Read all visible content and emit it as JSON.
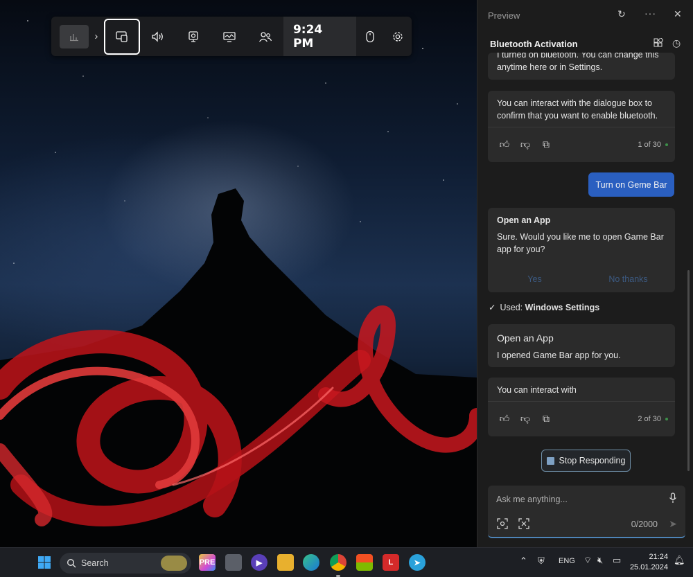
{
  "gamebar": {
    "time": "9:24 PM",
    "widgets": [
      "performance-icon",
      "capture-icon",
      "audio-icon",
      "webcam-icon",
      "display-icon",
      "social-icon"
    ]
  },
  "panel": {
    "header_label": "Preview",
    "title": "Bluetooth Activation",
    "msg1_partial": "I turned on bluetooth. You can change this anytime here or in Settings.",
    "msg2_line1": "You can interact with the dialogue box to",
    "msg2_line2": "confirm that you want to enable bluetooth.",
    "msg2_count": "1 of 30",
    "user_button": "Turn on Geme Bar",
    "card3_title": "Open an App",
    "card3_line1": "Sure. Would you like me to open Game Bar",
    "card3_line2": "app for you?",
    "yes_label": "Yes",
    "no_label": "No thanks",
    "used_prefix": "Used: ",
    "used_source": "Windows Settings",
    "card4_title": "Open an App",
    "card4_body": "I opened Game Bar app for you.",
    "msg5": "You can interact with",
    "msg5_count": "2 of 30",
    "stop_label": "Stop Responding",
    "input_placeholder": "Ask me anything...",
    "char_count": "0/2000"
  },
  "taskbar": {
    "search_label": "Search",
    "language": "ENG",
    "time": "21:24",
    "date": "25.01.2024"
  },
  "colors": {
    "accent_blue": "#2a5fc0",
    "panel_bg": "#1c1c1c",
    "card_bg": "#2b2b2b"
  }
}
